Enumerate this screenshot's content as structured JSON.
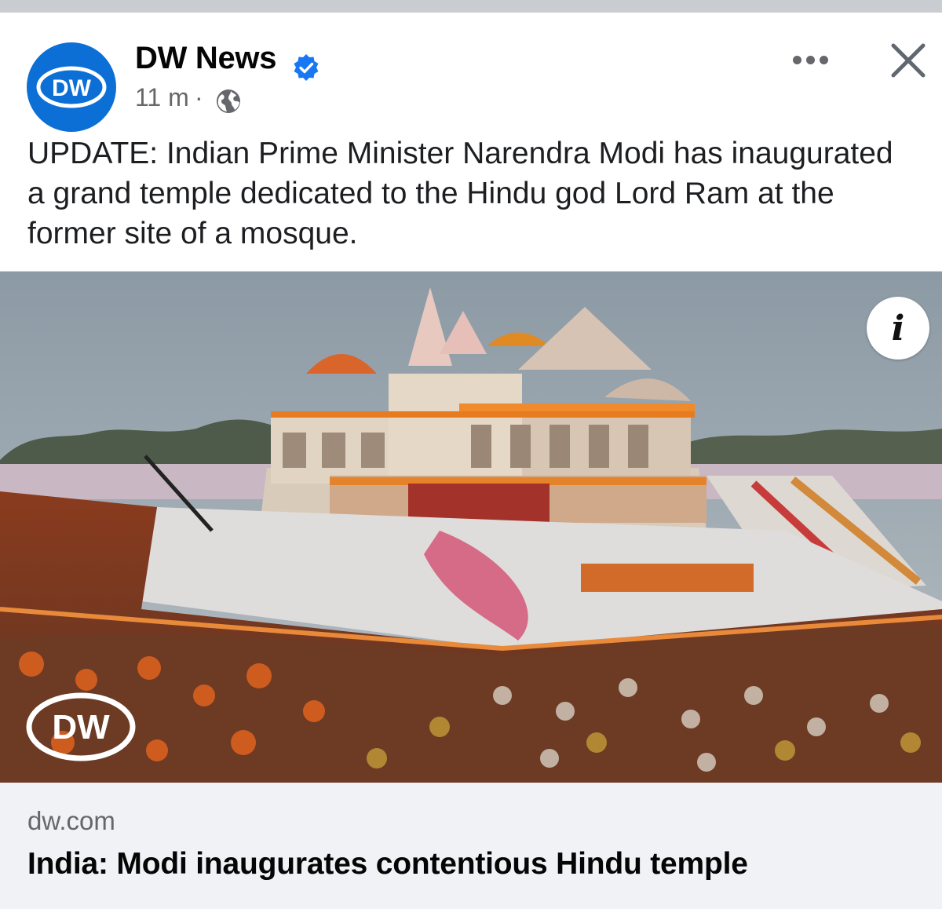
{
  "post": {
    "page_name": "DW News",
    "verified_icon": "verified-badge-icon",
    "time": "11 m",
    "separator": "·",
    "audience_icon": "globe-icon",
    "avatar_text": "DW",
    "text": "UPDATE: Indian Prime Minister Narendra Modi has inaugurated a grand temple dedicated to the Hindu god Lord Ram at the former site of a mosque.",
    "info_label": "i",
    "watermark_text": "DW"
  },
  "link_preview": {
    "domain": "dw.com",
    "title": "India: Modi inaugurates contentious Hindu temple"
  },
  "colors": {
    "brand_blue": "#0b6fd6",
    "verified_blue": "#1877f2",
    "secondary_text": "#65676b",
    "link_bg": "#f0f2f5"
  }
}
